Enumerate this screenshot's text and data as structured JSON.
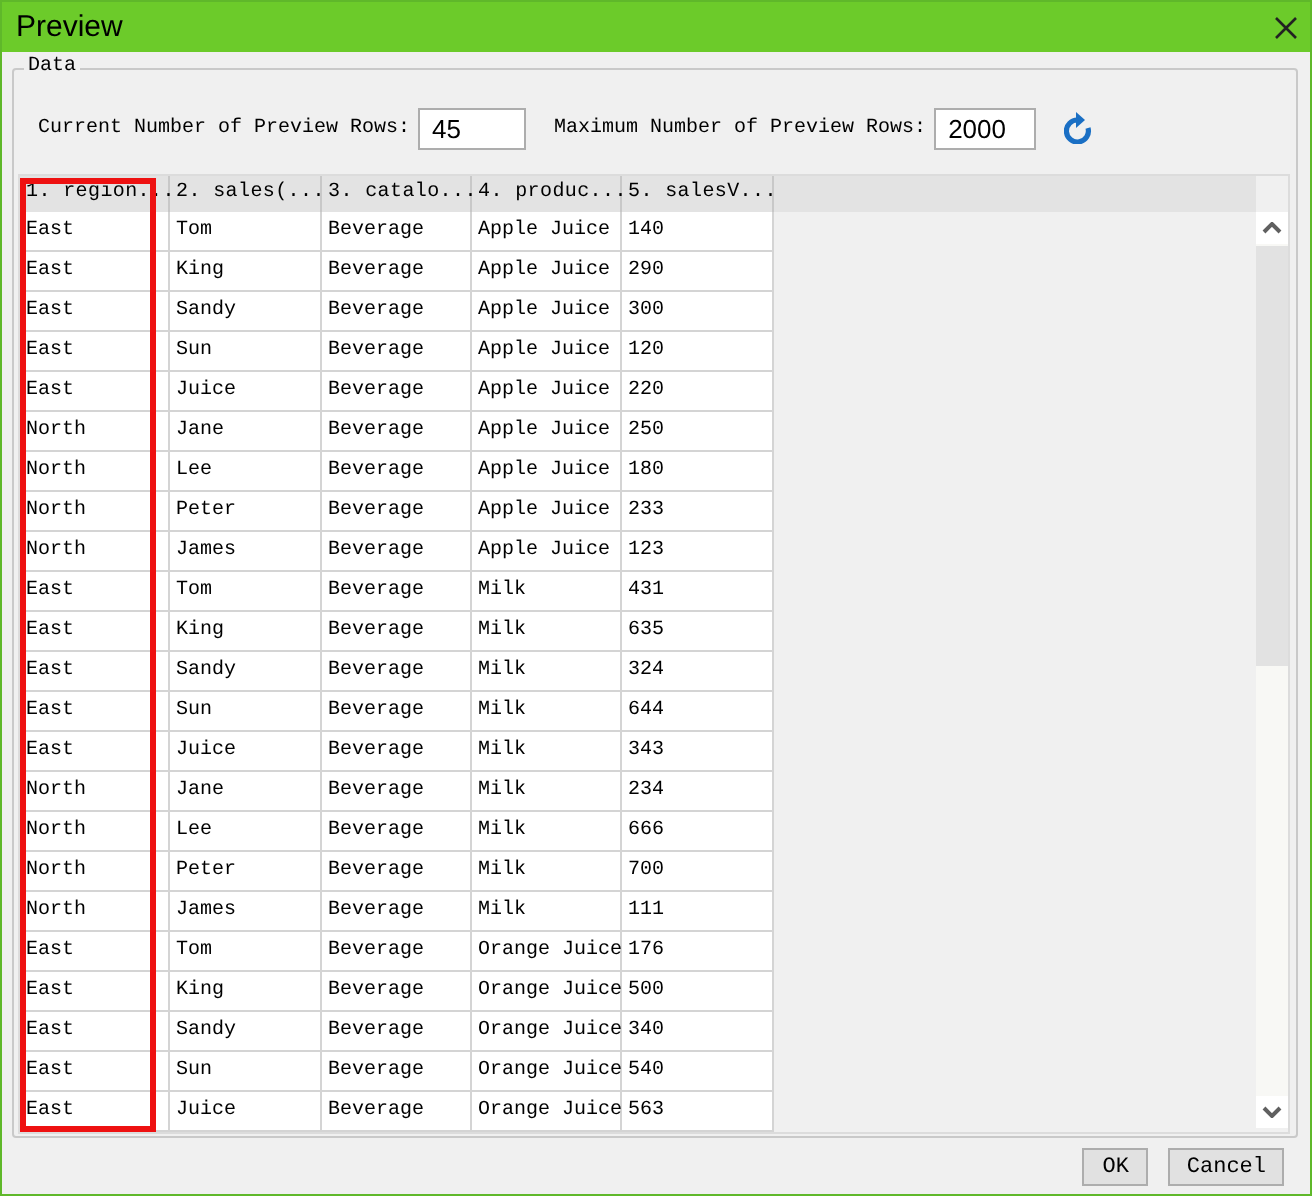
{
  "window": {
    "title": "Preview"
  },
  "group": {
    "title": "Data"
  },
  "options": {
    "current_label": "Current Number of  Preview Rows:",
    "current_value": "45",
    "max_label": "Maximum Number of Preview Rows:",
    "max_value": "2000"
  },
  "table": {
    "columns": [
      {
        "label": "1. region...",
        "highlighted": true
      },
      {
        "label": "2. sales(...",
        "highlighted": false
      },
      {
        "label": "3. catalo...",
        "highlighted": false
      },
      {
        "label": "4. produc...",
        "highlighted": false
      },
      {
        "label": "5. salesV...",
        "highlighted": false
      }
    ],
    "rows": [
      [
        "East",
        "Tom",
        "Beverage",
        "Apple Juice",
        "140"
      ],
      [
        "East",
        "King",
        "Beverage",
        "Apple Juice",
        "290"
      ],
      [
        "East",
        "Sandy",
        "Beverage",
        "Apple Juice",
        "300"
      ],
      [
        "East",
        "Sun",
        "Beverage",
        "Apple Juice",
        "120"
      ],
      [
        "East",
        "Juice",
        "Beverage",
        "Apple Juice",
        "220"
      ],
      [
        "North",
        "Jane",
        "Beverage",
        "Apple Juice",
        "250"
      ],
      [
        "North",
        "Lee",
        "Beverage",
        "Apple Juice",
        "180"
      ],
      [
        "North",
        "Peter",
        "Beverage",
        "Apple Juice",
        "233"
      ],
      [
        "North",
        "James",
        "Beverage",
        "Apple Juice",
        "123"
      ],
      [
        "East",
        "Tom",
        "Beverage",
        "Milk",
        "431"
      ],
      [
        "East",
        "King",
        "Beverage",
        "Milk",
        "635"
      ],
      [
        "East",
        "Sandy",
        "Beverage",
        "Milk",
        "324"
      ],
      [
        "East",
        "Sun",
        "Beverage",
        "Milk",
        "644"
      ],
      [
        "East",
        "Juice",
        "Beverage",
        "Milk",
        "343"
      ],
      [
        "North",
        "Jane",
        "Beverage",
        "Milk",
        "234"
      ],
      [
        "North",
        "Lee",
        "Beverage",
        "Milk",
        "666"
      ],
      [
        "North",
        "Peter",
        "Beverage",
        "Milk",
        "700"
      ],
      [
        "North",
        "James",
        "Beverage",
        "Milk",
        "111"
      ],
      [
        "East",
        "Tom",
        "Beverage",
        "Orange Juice",
        "176"
      ],
      [
        "East",
        "King",
        "Beverage",
        "Orange Juice",
        "500"
      ],
      [
        "East",
        "Sandy",
        "Beverage",
        "Orange Juice",
        "340"
      ],
      [
        "East",
        "Sun",
        "Beverage",
        "Orange Juice",
        "540"
      ],
      [
        "East",
        "Juice",
        "Beverage",
        "Orange Juice",
        "563"
      ]
    ]
  },
  "buttons": [
    "OK",
    "Cancel"
  ]
}
